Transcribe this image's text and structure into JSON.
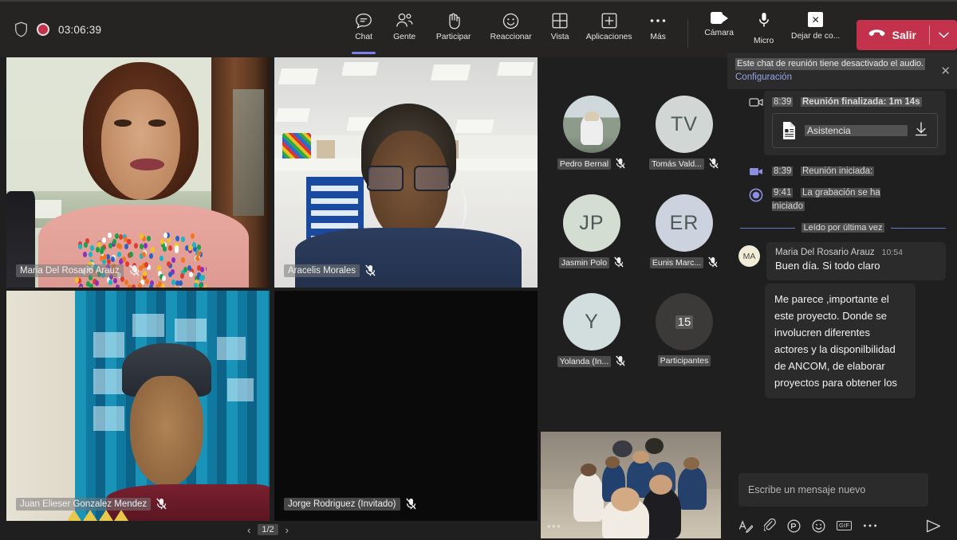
{
  "topbar": {
    "shield_icon": "shield-icon",
    "record_icon": "recording-dot-icon",
    "timer": "03:06:39",
    "buttons": [
      {
        "label": "Chat",
        "icon": "chat-icon",
        "active": true
      },
      {
        "label": "Gente",
        "icon": "people-icon",
        "active": false
      },
      {
        "label": "Participar",
        "icon": "raise-hand-icon",
        "active": false
      },
      {
        "label": "Reaccionar",
        "icon": "emoji-smile-icon",
        "active": false
      },
      {
        "label": "Vista",
        "icon": "grid-view-icon",
        "active": false
      },
      {
        "label": "Aplicaciones",
        "icon": "plus-square-icon",
        "active": false
      },
      {
        "label": "Más",
        "icon": "ellipsis-icon",
        "active": false
      }
    ],
    "device_buttons": [
      {
        "label": "Cámara",
        "icon": "camera-icon"
      },
      {
        "label": "Micro",
        "icon": "microphone-icon"
      },
      {
        "label": "Dejar de co...",
        "icon": "stop-share-icon"
      }
    ],
    "leave": {
      "label": "Salir",
      "icon": "hangup-icon",
      "caret": "chevron-down-icon",
      "color": "#c4314b"
    }
  },
  "stage": {
    "tiles": [
      {
        "name": "Maria Del Rosario Arauz",
        "muted": true,
        "camera_on": true
      },
      {
        "name": "Aracelis Morales",
        "muted": true,
        "camera_on": true
      },
      {
        "name": "Juan Elieser Gonzalez Mendez",
        "muted": true,
        "camera_on": true
      },
      {
        "name": "Jorge Rodriguez (Invitado)",
        "muted": true,
        "camera_on": false
      }
    ],
    "pager": {
      "prev": "‹",
      "page": "1/2",
      "next": "›"
    }
  },
  "roster": {
    "items": [
      {
        "name": "Pedro Bernal",
        "initials": "",
        "muted": true,
        "has_photo": true,
        "bg": "#c9d2c8"
      },
      {
        "name": "Tomás Vald...",
        "initials": "TV",
        "muted": true,
        "has_photo": false,
        "bg": "#d2d6d4"
      },
      {
        "name": "Jasmin Polo",
        "initials": "JP",
        "muted": true,
        "has_photo": false,
        "bg": "#d4ddd2"
      },
      {
        "name": "Eunis Marc...",
        "initials": "ER",
        "muted": true,
        "has_photo": false,
        "bg": "#ccd2de"
      },
      {
        "name": "Yolanda (In...",
        "initials": "Y",
        "muted": true,
        "has_photo": false,
        "bg": "#d2dedd"
      }
    ],
    "overflow": {
      "count": "15",
      "label": "Participantes"
    },
    "group_tile_overflow_icon": "ellipsis-icon"
  },
  "chat": {
    "notice": {
      "text": "Este chat de reunión tiene desactivado el audio.",
      "link": "Configuración",
      "close_icon": "close-icon"
    },
    "events": [
      {
        "icon": "camera-off-icon",
        "time": "8:39",
        "text": "Reunión finalizada: 1m 14s",
        "attachment": {
          "name": "Asistencia",
          "file_icon": "document-icon",
          "download_icon": "download-icon"
        }
      },
      {
        "icon": "camera-icon",
        "time": "8:39",
        "text": "Reunión iniciada:"
      },
      {
        "icon": "record-icon",
        "time": "9:41",
        "text": "La grabación se ha iniciado"
      }
    ],
    "divider_label": "Leído por última vez",
    "messages": [
      {
        "author": "Maria Del Rosario Arauz",
        "initials": "MA",
        "time": "10:54",
        "body": "Buen día. Si todo claro"
      },
      {
        "author": "",
        "initials": "",
        "time": "",
        "body": "Me parece ,importante el este proyecto.  Donde  se involucren diferentes  actores  y la disponilbilidad de  ANCOM,  de elaborar proyectos para obtener los"
      }
    ],
    "compose": {
      "placeholder": "Escribe un mensaje nuevo",
      "tools": [
        {
          "icon": "format-text-icon"
        },
        {
          "icon": "attach-clip-icon"
        },
        {
          "icon": "sticker-icon"
        },
        {
          "icon": "emoji-icon"
        },
        {
          "icon": "gif-icon",
          "label": "GIF"
        },
        {
          "icon": "ellipsis-icon"
        }
      ],
      "send_icon": "send-icon"
    }
  },
  "colors": {
    "accent": "#7b83eb",
    "leave_red": "#c4314b",
    "panel_bg": "#1f1f1f",
    "bar_bg": "#252423",
    "bubble_bg": "#2b2b2b"
  }
}
